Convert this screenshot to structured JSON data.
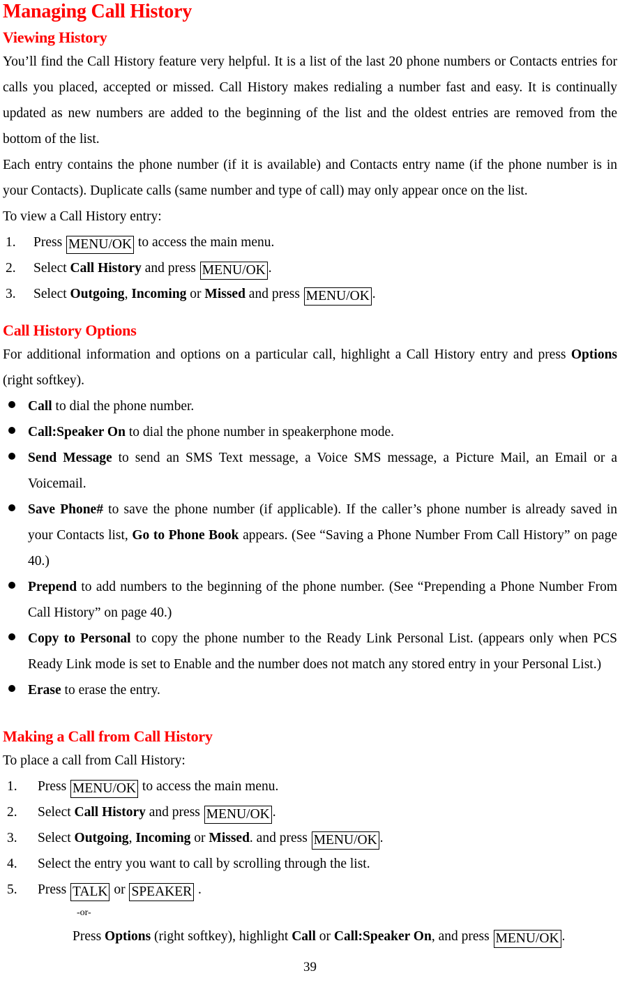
{
  "document": {
    "title": "Managing Call History",
    "page_number": "39"
  },
  "sections": {
    "viewing_history": {
      "heading": "Viewing History",
      "para1": "You’ll find the Call History feature very helpful. It is a list of the last 20 phone numbers or Contacts entries for calls you placed, accepted or missed. Call History makes redialing a number fast and easy. It is continually updated as new numbers are added to the beginning of the list and the oldest entries are removed from the bottom of the list.",
      "para2": "Each entry contains the phone number (if it is available) and Contacts entry name (if the phone number is in your Contacts). Duplicate calls (same number and type of call) may only appear once on the list.",
      "lead_in": "To view a Call History entry:",
      "steps": [
        {
          "num": "1.",
          "pre": "Press ",
          "key1": "MENU/OK",
          "post": " to access the main menu."
        },
        {
          "num": "2.",
          "pre": "Select ",
          "bold1": "Call History",
          "mid": " and press ",
          "key1": "MENU/OK",
          "post": "."
        },
        {
          "num": "3.",
          "pre": "Select ",
          "bold1": "Outgoing",
          "sep1": ", ",
          "bold2": "Incoming",
          "sep2": " or ",
          "bold3": "Missed",
          "mid": " and press ",
          "key1": "MENU/OK",
          "post": "."
        }
      ]
    },
    "call_history_options": {
      "heading": "Call History Options",
      "intro_pre": "For additional information and options on a particular call, highlight a Call History entry and press ",
      "intro_bold": "Options",
      "intro_post": " (right softkey).",
      "bullets": [
        {
          "bold": "Call",
          "text": " to dial the phone number."
        },
        {
          "bold": "Call:Speaker On",
          "text": " to dial the phone number in speakerphone mode."
        },
        {
          "bold": "Send Message",
          "text": " to send an SMS Text message, a Voice SMS message, a Picture Mail, an Email or a Voicemail."
        },
        {
          "bold": "Save Phone#",
          "text": " to save the phone number (if applicable). If the caller’s phone number is already saved in your Contacts list, ",
          "bold2": "Go to Phone Book",
          "text2": " appears. (See “Saving a Phone Number From Call History” on page 40.)"
        },
        {
          "bold": "Prepend",
          "text": " to add numbers to the beginning of the phone number. (See “Prepending a Phone Number From Call History” on page 40.)"
        },
        {
          "bold": "Copy to Personal",
          "text": " to copy the phone number to the Ready Link Personal List. (appears only when PCS Ready Link mode is set to Enable and the number does not match any stored entry in your Personal List.)"
        },
        {
          "bold": "Erase",
          "text": " to erase the entry."
        }
      ]
    },
    "making_a_call": {
      "heading": "Making a Call from Call History",
      "lead_in": "To place a call from Call History:",
      "steps": [
        {
          "num": "1.",
          "pre": "Press ",
          "key1": "MENU/OK",
          "post": " to access the main menu."
        },
        {
          "num": "2.",
          "pre": "Select ",
          "bold1": "Call History",
          "mid": " and press ",
          "key1": "MENU/OK",
          "post": "."
        },
        {
          "num": "3.",
          "pre": "Select ",
          "bold1": "Outgoing",
          "sep1": ", ",
          "bold2": "Incoming",
          "sep2": " or ",
          "bold3": "Missed",
          "mid": ". and press ",
          "key1": "MENU/OK",
          "post": "."
        },
        {
          "num": "4.",
          "pre": "Select the entry you want to call by scrolling through the list."
        },
        {
          "num": "5.",
          "pre": "Press ",
          "key1": "TALK",
          "mid": " or ",
          "key2": "SPEAKER",
          "post": " .",
          "or_label": "-or-",
          "alt_pre": "Press ",
          "alt_bold1": "Options",
          "alt_mid1": " (right softkey), highlight ",
          "alt_bold2": "Call",
          "alt_mid2": " or ",
          "alt_bold3": "Call:Speaker On",
          "alt_mid3": ", and press ",
          "alt_key": "MENU/OK",
          "alt_post": "."
        }
      ]
    }
  },
  "colors": {
    "heading_red": "#ff0000",
    "body_black": "#000000",
    "page_background": "#ffffff"
  }
}
